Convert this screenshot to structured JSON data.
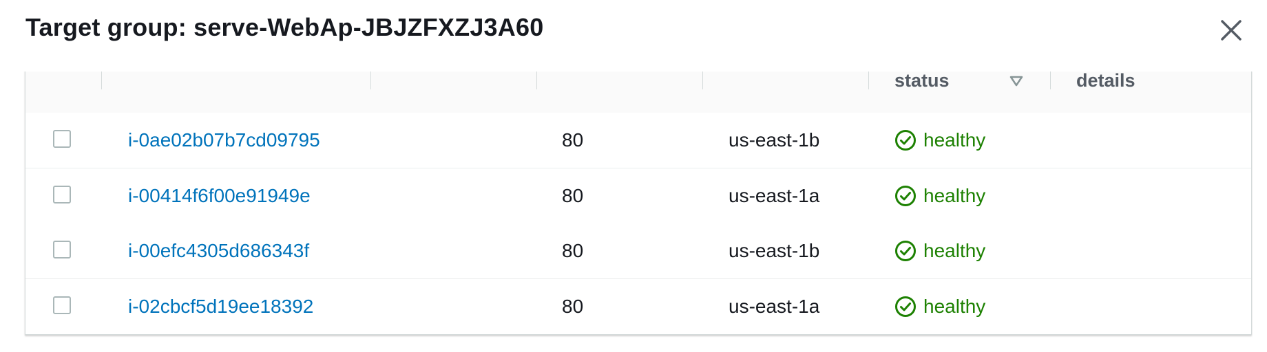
{
  "modal": {
    "title": "Target group: serve-WebAp-JBJZFXZJ3A60",
    "close_icon": "close-icon"
  },
  "table": {
    "visible_headers": {
      "health_status": "status",
      "health_details": "details"
    },
    "rows": [
      {
        "instance_id": "i-0ae02b07b7cd09795",
        "port": "80",
        "zone": "us-east-1b",
        "health_status": "healthy"
      },
      {
        "instance_id": "i-00414f6f00e91949e",
        "port": "80",
        "zone": "us-east-1a",
        "health_status": "healthy"
      },
      {
        "instance_id": "i-00efc4305d686343f",
        "port": "80",
        "zone": "us-east-1b",
        "health_status": "healthy"
      },
      {
        "instance_id": "i-02cbcf5d19ee18392",
        "port": "80",
        "zone": "us-east-1a",
        "health_status": "healthy"
      }
    ]
  },
  "colors": {
    "link": "#0073bb",
    "healthy": "#1d8102",
    "header_text": "#545b64",
    "title_text": "#16191f"
  }
}
